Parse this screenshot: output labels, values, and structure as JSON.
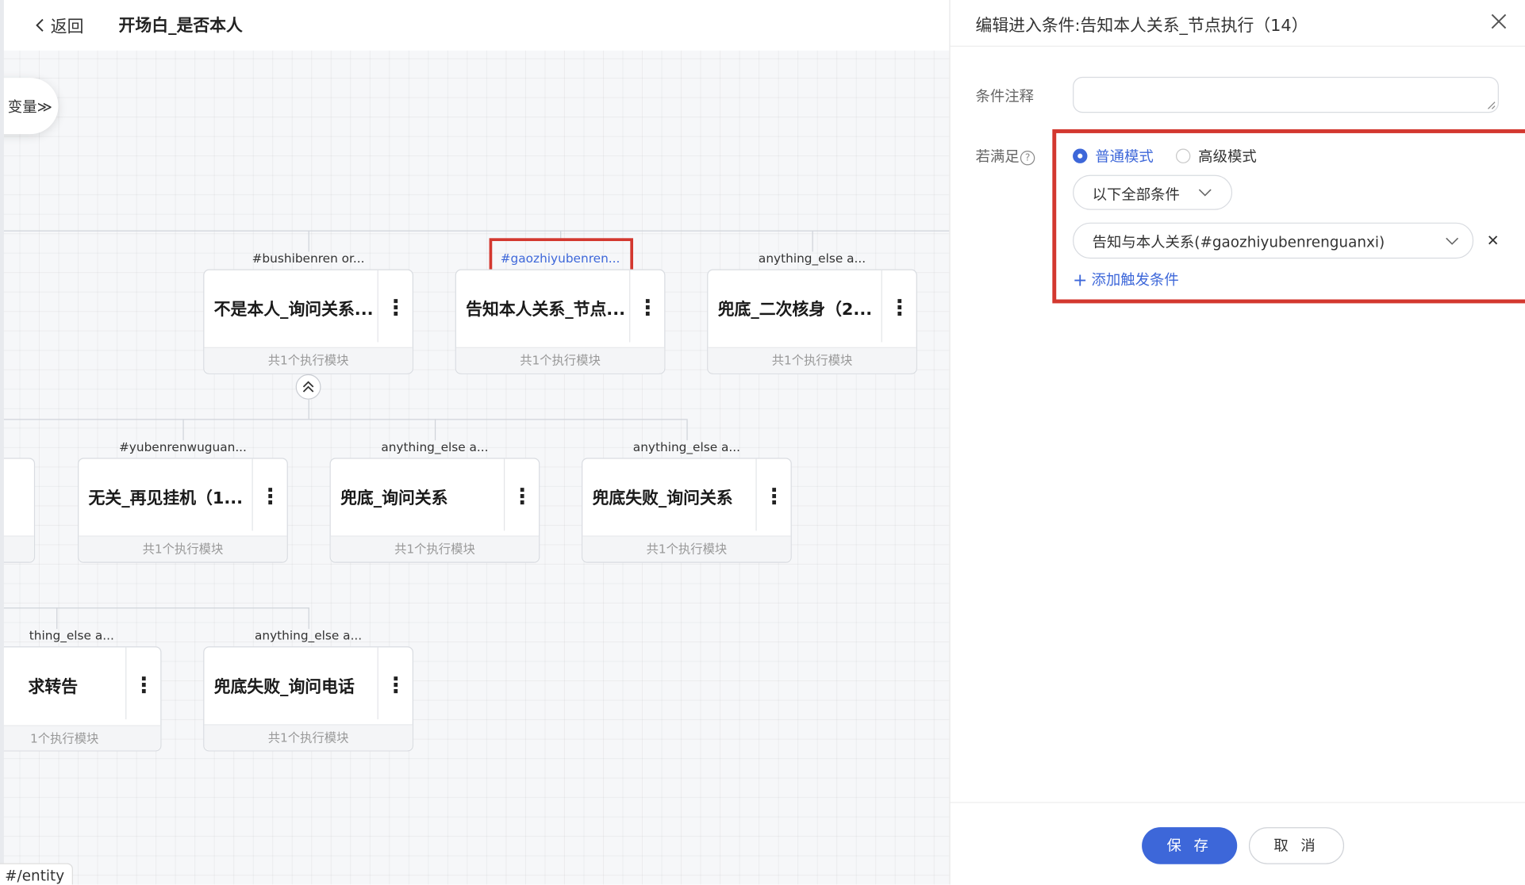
{
  "header": {
    "back_label": "返回",
    "title": "开场白_是否本人"
  },
  "variables_tab": {
    "label": "变量≫"
  },
  "entity_tag": "#/entity",
  "flow": {
    "row1": [
      {
        "condition": "#bushibenren or...",
        "name": "不是本人_询问关系...",
        "footer": "共1个执行模块"
      },
      {
        "condition": "#gaozhiyubenren...",
        "name": "告知本人关系_节点...",
        "footer": "共1个执行模块",
        "selected": true
      },
      {
        "condition": "anything_else a...",
        "name": "兜底_二次核身（2...",
        "footer": "共1个执行模块"
      }
    ],
    "row2": [
      {
        "condition": "#yubenrenwuguan...",
        "name": "无关_再见挂机（1...",
        "footer": "共1个执行模块"
      },
      {
        "condition": "anything_else a...",
        "name": "兜底_询问关系",
        "footer": "共1个执行模块"
      },
      {
        "condition": "anything_else a...",
        "name": "兜底失败_询问关系",
        "footer": "共1个执行模块"
      }
    ],
    "row3": [
      {
        "condition": "thing_else a...",
        "name": "求转告",
        "footer": "1个执行模块"
      },
      {
        "condition": "anything_else a...",
        "name": "兜底失败_询问电话",
        "footer": "共1个执行模块"
      }
    ],
    "more_icon": "⋮"
  },
  "panel": {
    "title": "编辑进入条件:告知本人关系_节点执行（14）",
    "note_label": "条件注释",
    "note_value": "",
    "condition_label": "若满足",
    "help_icon": "?",
    "mode_normal": "普通模式",
    "mode_advanced": "高级模式",
    "selected_mode": "normal",
    "match_type": "以下全部条件",
    "conditions": [
      "告知与本人关系(#gaozhiyubenrenguanxi)"
    ],
    "add_trigger": "添加触发条件",
    "add_icon": "+",
    "save": "保 存",
    "cancel": "取 消"
  },
  "colors": {
    "accent": "#3d67d9",
    "highlight_box": "#d3382f"
  }
}
